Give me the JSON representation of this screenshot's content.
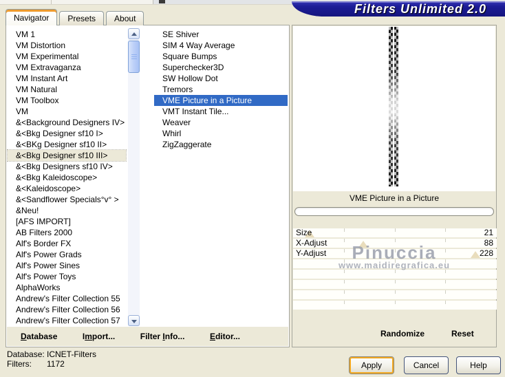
{
  "banner": {
    "title": "Filters Unlimited 2.0"
  },
  "tabs": [
    {
      "label": "Navigator",
      "active": true
    },
    {
      "label": "Presets",
      "active": false
    },
    {
      "label": "About",
      "active": false
    }
  ],
  "category_list": {
    "selected": "&<Bkg Designer sf10 III>",
    "items": [
      "VM 1",
      "VM Distortion",
      "VM Experimental",
      "VM Extravaganza",
      "VM Instant Art",
      "VM Natural",
      "VM Toolbox",
      "VM",
      "&<Background Designers IV>",
      "&<Bkg Designer sf10 I>",
      "&<BKg Designer sf10 II>",
      "&<Bkg Designer sf10 III>",
      "&<Bkg Designers sf10 IV>",
      "&<Bkg Kaleidoscope>",
      "&<Kaleidoscope>",
      "&<Sandflower Specials°v° >",
      "&Neu!",
      "[AFS IMPORT]",
      "AB Filters 2000",
      "Alf's Border FX",
      "Alf's Power Grads",
      "Alf's Power Sines",
      "Alf's Power Toys",
      "AlphaWorks",
      "Andrew's Filter Collection 55",
      "Andrew's Filter Collection 56",
      "Andrew's Filter Collection 57"
    ]
  },
  "filter_list": {
    "selected": "VME Picture in a Picture",
    "items": [
      "SE Shiver",
      "SIM 4 Way Average",
      "Square Bumps",
      "Superchecker3D",
      "SW Hollow Dot",
      "Tremors",
      "VME Picture in a Picture",
      "VMT Instant Tile...",
      "Weaver",
      "Whirl",
      "ZigZaggerate"
    ]
  },
  "preview": {
    "caption": "VME Picture in a Picture"
  },
  "parameters": {
    "range_max": 255,
    "sliders": [
      {
        "label": "Size",
        "value": 21
      },
      {
        "label": "X-Adjust",
        "value": 88
      },
      {
        "label": "Y-Adjust",
        "value": 228
      }
    ],
    "empty_rows": 5
  },
  "watermark": {
    "line1": "Pinuccia",
    "line2": "www.maidiregrafica.eu"
  },
  "toolbar": [
    {
      "label": "Database",
      "mnemonic_index": 0
    },
    {
      "label": "Import...",
      "mnemonic_index": 1
    },
    {
      "label": "Filter Info...",
      "mnemonic_index": 7
    },
    {
      "label": "Editor...",
      "mnemonic_index": 0
    }
  ],
  "actions": {
    "randomize": "Randomize",
    "reset": "Reset"
  },
  "status": {
    "database_label": "Database:",
    "database_value": "ICNET-Filters",
    "filters_label": "Filters:",
    "filters_value": "1172"
  },
  "buttons": {
    "apply": "Apply",
    "cancel": "Cancel",
    "help": "Help"
  },
  "colors": {
    "selection_blue": "#316ac5",
    "banner_blue": "#1c1c96",
    "tab_accent": "#ef9b2e",
    "dialog_face": "#ece9d8"
  }
}
